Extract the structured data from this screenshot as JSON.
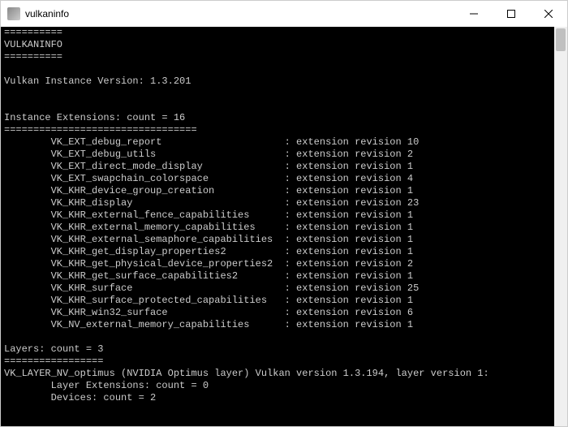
{
  "window": {
    "title": "vulkaninfo"
  },
  "console": {
    "sep1": "==========",
    "heading": "VULKANINFO",
    "sep2": "==========",
    "instance_version_line": "Vulkan Instance Version: 1.3.201",
    "ext_header": "Instance Extensions: count = 16",
    "ext_sep": "=================================",
    "extensions": [
      {
        "name": "VK_EXT_debug_report",
        "rev": "10"
      },
      {
        "name": "VK_EXT_debug_utils",
        "rev": "2"
      },
      {
        "name": "VK_EXT_direct_mode_display",
        "rev": "1"
      },
      {
        "name": "VK_EXT_swapchain_colorspace",
        "rev": "4"
      },
      {
        "name": "VK_KHR_device_group_creation",
        "rev": "1"
      },
      {
        "name": "VK_KHR_display",
        "rev": "23"
      },
      {
        "name": "VK_KHR_external_fence_capabilities",
        "rev": "1"
      },
      {
        "name": "VK_KHR_external_memory_capabilities",
        "rev": "1"
      },
      {
        "name": "VK_KHR_external_semaphore_capabilities",
        "rev": "1"
      },
      {
        "name": "VK_KHR_get_display_properties2",
        "rev": "1"
      },
      {
        "name": "VK_KHR_get_physical_device_properties2",
        "rev": "2"
      },
      {
        "name": "VK_KHR_get_surface_capabilities2",
        "rev": "1"
      },
      {
        "name": "VK_KHR_surface",
        "rev": "25"
      },
      {
        "name": "VK_KHR_surface_protected_capabilities",
        "rev": "1"
      },
      {
        "name": "VK_KHR_win32_surface",
        "rev": "6"
      },
      {
        "name": "VK_NV_external_memory_capabilities",
        "rev": "1"
      }
    ],
    "layers_header": "Layers: count = 3",
    "layers_sep": "=================",
    "layer_line": "VK_LAYER_NV_optimus (NVIDIA Optimus layer) Vulkan version 1.3.194, layer version 1:",
    "layer_ext_line": "Layer Extensions: count = 0",
    "devices_line": "Devices: count = 2"
  }
}
